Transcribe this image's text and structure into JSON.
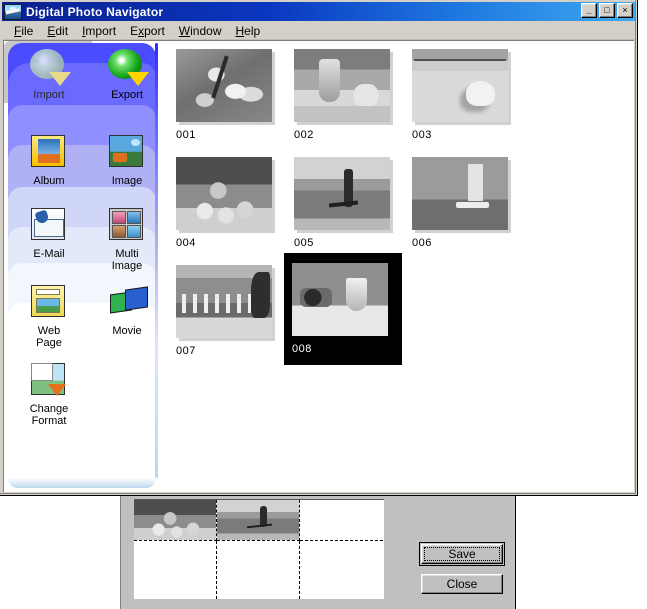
{
  "window": {
    "title": "Digital Photo Navigator",
    "icon": "photo-navigator-icon",
    "controls": {
      "minimize": "_",
      "maximize": "□",
      "close": "×"
    }
  },
  "menu": [
    {
      "label": "File",
      "accel": "F"
    },
    {
      "label": "Edit",
      "accel": "E"
    },
    {
      "label": "Import",
      "accel": "I"
    },
    {
      "label": "Export",
      "accel": "E"
    },
    {
      "label": "Window",
      "accel": "W"
    },
    {
      "label": "Help",
      "accel": "H"
    }
  ],
  "sidebar": {
    "tabs": [
      {
        "label": "Import",
        "icon": "import-disc-arrow-icon",
        "active": false
      },
      {
        "label": "Export",
        "icon": "export-disc-arrow-icon",
        "active": true
      }
    ],
    "items": [
      {
        "label": "Album",
        "icon": "album-icon"
      },
      {
        "label": "Image",
        "icon": "image-icon"
      },
      {
        "label": "E-Mail",
        "icon": "email-icon"
      },
      {
        "label": "Multi\nImage",
        "icon": "multi-image-icon"
      },
      {
        "label": "Web\nPage",
        "icon": "web-page-icon"
      },
      {
        "label": "Movie",
        "icon": "movie-icon"
      },
      {
        "label": "Change\nFormat",
        "icon": "change-format-icon"
      }
    ]
  },
  "thumbnails": [
    {
      "label": "001",
      "subject": "flowers",
      "selected": false
    },
    {
      "label": "002",
      "subject": "glassware",
      "selected": false
    },
    {
      "label": "003",
      "subject": "seashell",
      "selected": false
    },
    {
      "label": "004",
      "subject": "fruit-bowl",
      "selected": false
    },
    {
      "label": "005",
      "subject": "water-skier",
      "selected": false
    },
    {
      "label": "006",
      "subject": "windsurfer",
      "selected": false
    },
    {
      "label": "007",
      "subject": "parade",
      "selected": false
    },
    {
      "label": "008",
      "subject": "table-scene",
      "selected": true
    }
  ],
  "dialog": {
    "layout": {
      "columns": 3,
      "rows": 2,
      "cells": [
        {
          "filled": true,
          "subject": "fruit-bowl"
        },
        {
          "filled": true,
          "subject": "water-skier"
        },
        {
          "filled": false,
          "subject": ""
        },
        {
          "filled": false,
          "subject": ""
        },
        {
          "filled": false,
          "subject": ""
        },
        {
          "filled": false,
          "subject": ""
        }
      ]
    },
    "buttons": {
      "save": "Save",
      "close": "Close"
    }
  },
  "colors": {
    "titlebar_start": "#0b1f8f",
    "titlebar_end": "#3fa9f0",
    "panel_blue": "#4b4bff",
    "window_face": "#d4d0c8",
    "dialog_face": "#c0c0c0",
    "selection": "#000000"
  }
}
